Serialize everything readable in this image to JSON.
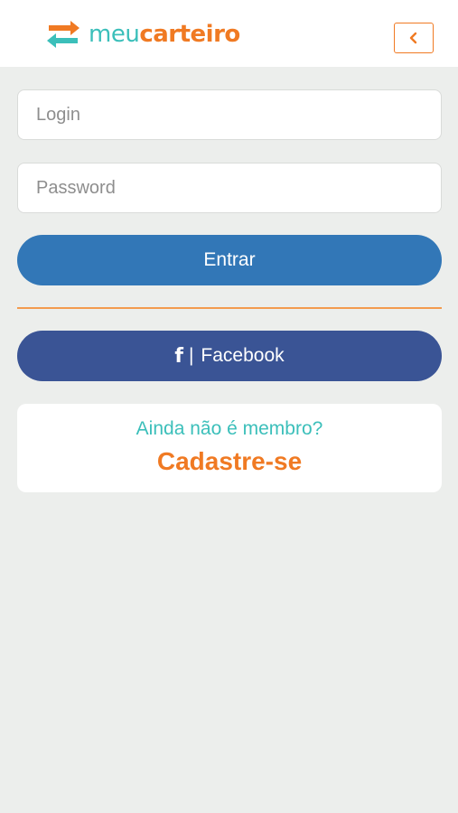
{
  "header": {
    "logo_part1": "meu",
    "logo_part2": "carteiro",
    "back_icon": "chevron-left-icon"
  },
  "form": {
    "login_placeholder": "Login",
    "login_value": "",
    "password_placeholder": "Password",
    "password_value": "",
    "submit_label": "Entrar"
  },
  "social": {
    "facebook_icon": "facebook-icon",
    "facebook_separator": "|",
    "facebook_label": "Facebook"
  },
  "signup": {
    "prompt": "Ainda não é membro?",
    "link_label": "Cadastre-se"
  },
  "colors": {
    "teal": "#3bbfba",
    "orange": "#f07a23",
    "primary_button": "#3277b7",
    "facebook_button": "#3a5495",
    "background": "#eceeec"
  }
}
